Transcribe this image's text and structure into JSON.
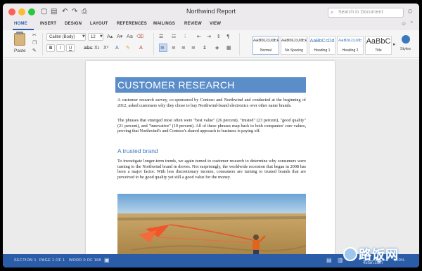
{
  "window": {
    "title": "Northwind Report",
    "search_placeholder": "Search in Document"
  },
  "tabs": [
    "HOME",
    "INSERT",
    "DESIGN",
    "LAYOUT",
    "REFERENCES",
    "MAILINGS",
    "REVIEW",
    "VIEW"
  ],
  "ribbon": {
    "paste_label": "Paste",
    "font_name": "Calibri (Body)",
    "font_size": "12",
    "bold": "B",
    "italic": "I",
    "underline": "U",
    "strike": "abc",
    "subscript": "X₂",
    "superscript": "X²",
    "styles": [
      {
        "sample": "AaBbCcDdEe",
        "name": "Normal"
      },
      {
        "sample": "AaBbCcDdEe",
        "name": "No Spacing"
      },
      {
        "sample": "AaBbCcDd",
        "name": "Heading 1"
      },
      {
        "sample": "AaBbCcDdE",
        "name": "Heading 2"
      },
      {
        "sample": "AaBbC",
        "name": "Title"
      }
    ],
    "styles_pane_label": "Styles"
  },
  "document": {
    "heading": "CUSTOMER RESEARCH",
    "para1": "A customer research survey, co-sponsored by Contoso and Northwind and conducted at the beginning of 2012, asked customers why they chose to buy Northwind-brand electronics over other name brands.",
    "para2": "The phrases that emerged most often were \"best value\" (26 percent), \"trusted\" (23 percent), \"good quality\" (21 percent), and \"innovative\" (19 percent). All of these phrases map back to both companies' core values, proving that Northwind's and Contoso's shared approach to business is paying off.",
    "subheading": "A trusted brand",
    "para3": "To investigate longer-term trends, we again turned to customer research to determine why consumers were turning to the Northwind brand in droves. Not surprisingly, the worldwide recession that began in 2008 has been a major factor. With less discretionary income, consumers are turning to trusted brands that are perceived to be good quality yet still a good value for the money."
  },
  "status": {
    "section": "SECTION 1",
    "page": "PAGE 1 OF 1",
    "words": "WORD 0 OF 168",
    "zoom": "100%"
  },
  "watermark": {
    "text": "路饭网",
    "url": "45fan.com"
  },
  "colors": {
    "accent": "#2b5ca8",
    "heading_banner": "#5b8dc9"
  }
}
